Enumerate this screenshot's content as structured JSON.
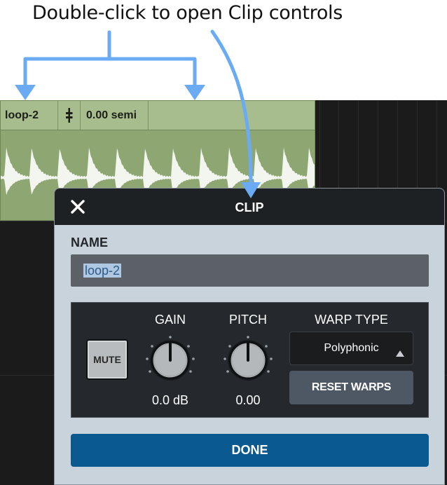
{
  "annotation": {
    "text": "Double-click to open Clip controls"
  },
  "clip": {
    "name": "loop-2",
    "pitch_readout": "0.00 semi",
    "icon": "pitch-marker-icon"
  },
  "dialog": {
    "title": "CLIP",
    "name_label": "NAME",
    "name_value": "loop-2",
    "mute_label": "MUTE",
    "gain": {
      "label": "GAIN",
      "value": "0.0 dB"
    },
    "pitch": {
      "label": "PITCH",
      "value": "0.00"
    },
    "warp": {
      "label": "WARP TYPE",
      "selected": "Polyphonic"
    },
    "reset_label": "RESET WARPS",
    "done_label": "DONE"
  },
  "colors": {
    "annotation_arrow": "#6aabf3",
    "clip_body": "#8ea772",
    "clip_header": "#a8bd8e",
    "dialog_bg": "#c9d3db",
    "dialog_header": "#1e2124",
    "done_button": "#0b5a8f",
    "reset_button": "#4d5864"
  }
}
